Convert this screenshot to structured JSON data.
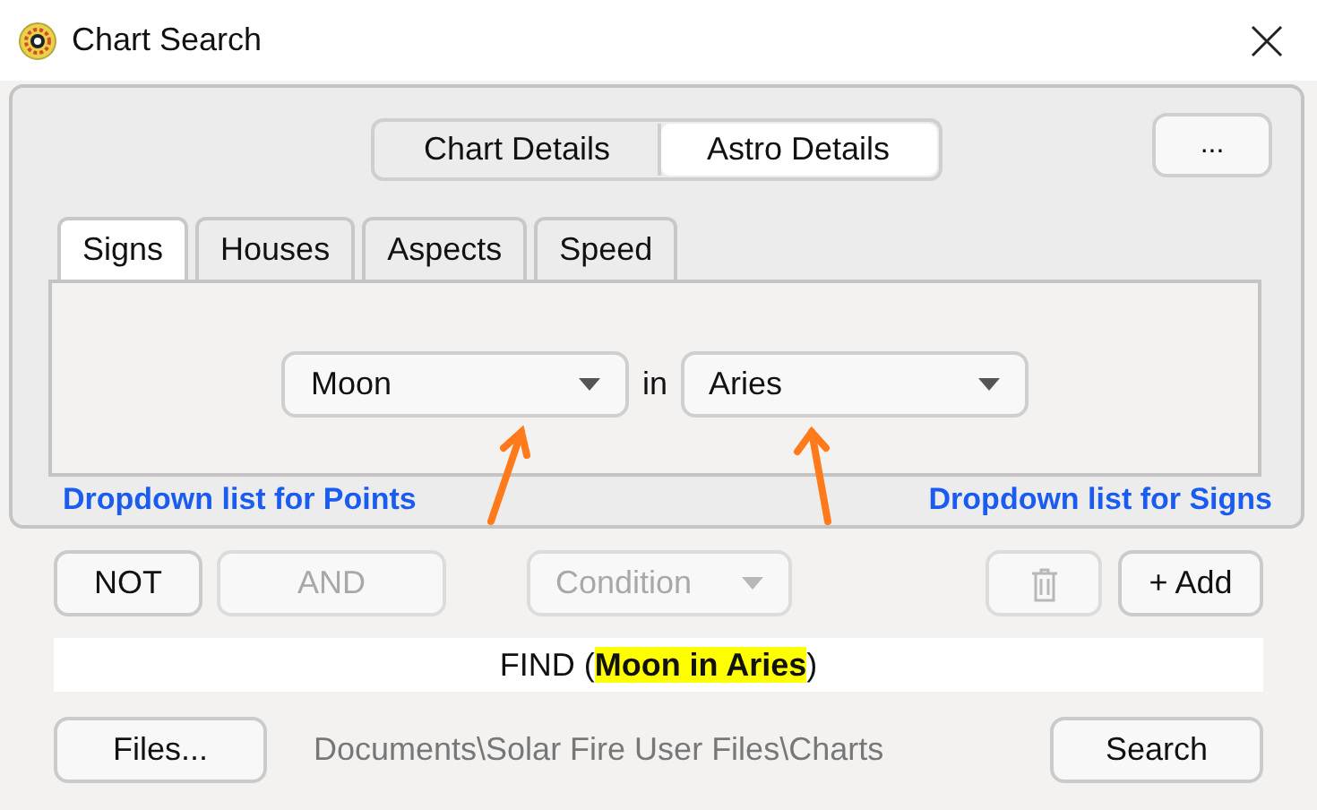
{
  "window": {
    "title": "Chart Search"
  },
  "view_switch": [
    {
      "label": "Chart Details",
      "selected": false
    },
    {
      "label": "Astro Details",
      "selected": true
    }
  ],
  "more_button": "...",
  "tabs": [
    {
      "label": "Signs",
      "selected": true
    },
    {
      "label": "Houses",
      "selected": false
    },
    {
      "label": "Aspects",
      "selected": false
    },
    {
      "label": "Speed",
      "selected": false
    }
  ],
  "criterion": {
    "point": "Moon",
    "connector": "in",
    "sign": "Aries"
  },
  "annotations": [
    {
      "text": "Dropdown list for Points"
    },
    {
      "text": "Dropdown list for Signs"
    }
  ],
  "logic_buttons": [
    {
      "label": "NOT",
      "disabled": false
    },
    {
      "label": "AND",
      "disabled": true
    }
  ],
  "condition": {
    "value": "Condition",
    "disabled": true
  },
  "delete_button": {
    "disabled": true
  },
  "add_button": "+ Add",
  "expression": "FIND (**Moon in Aries**)",
  "files_button": "Files...",
  "folder_path": "Documents\\Solar Fire User Files\\Charts",
  "search_button": "Search"
}
